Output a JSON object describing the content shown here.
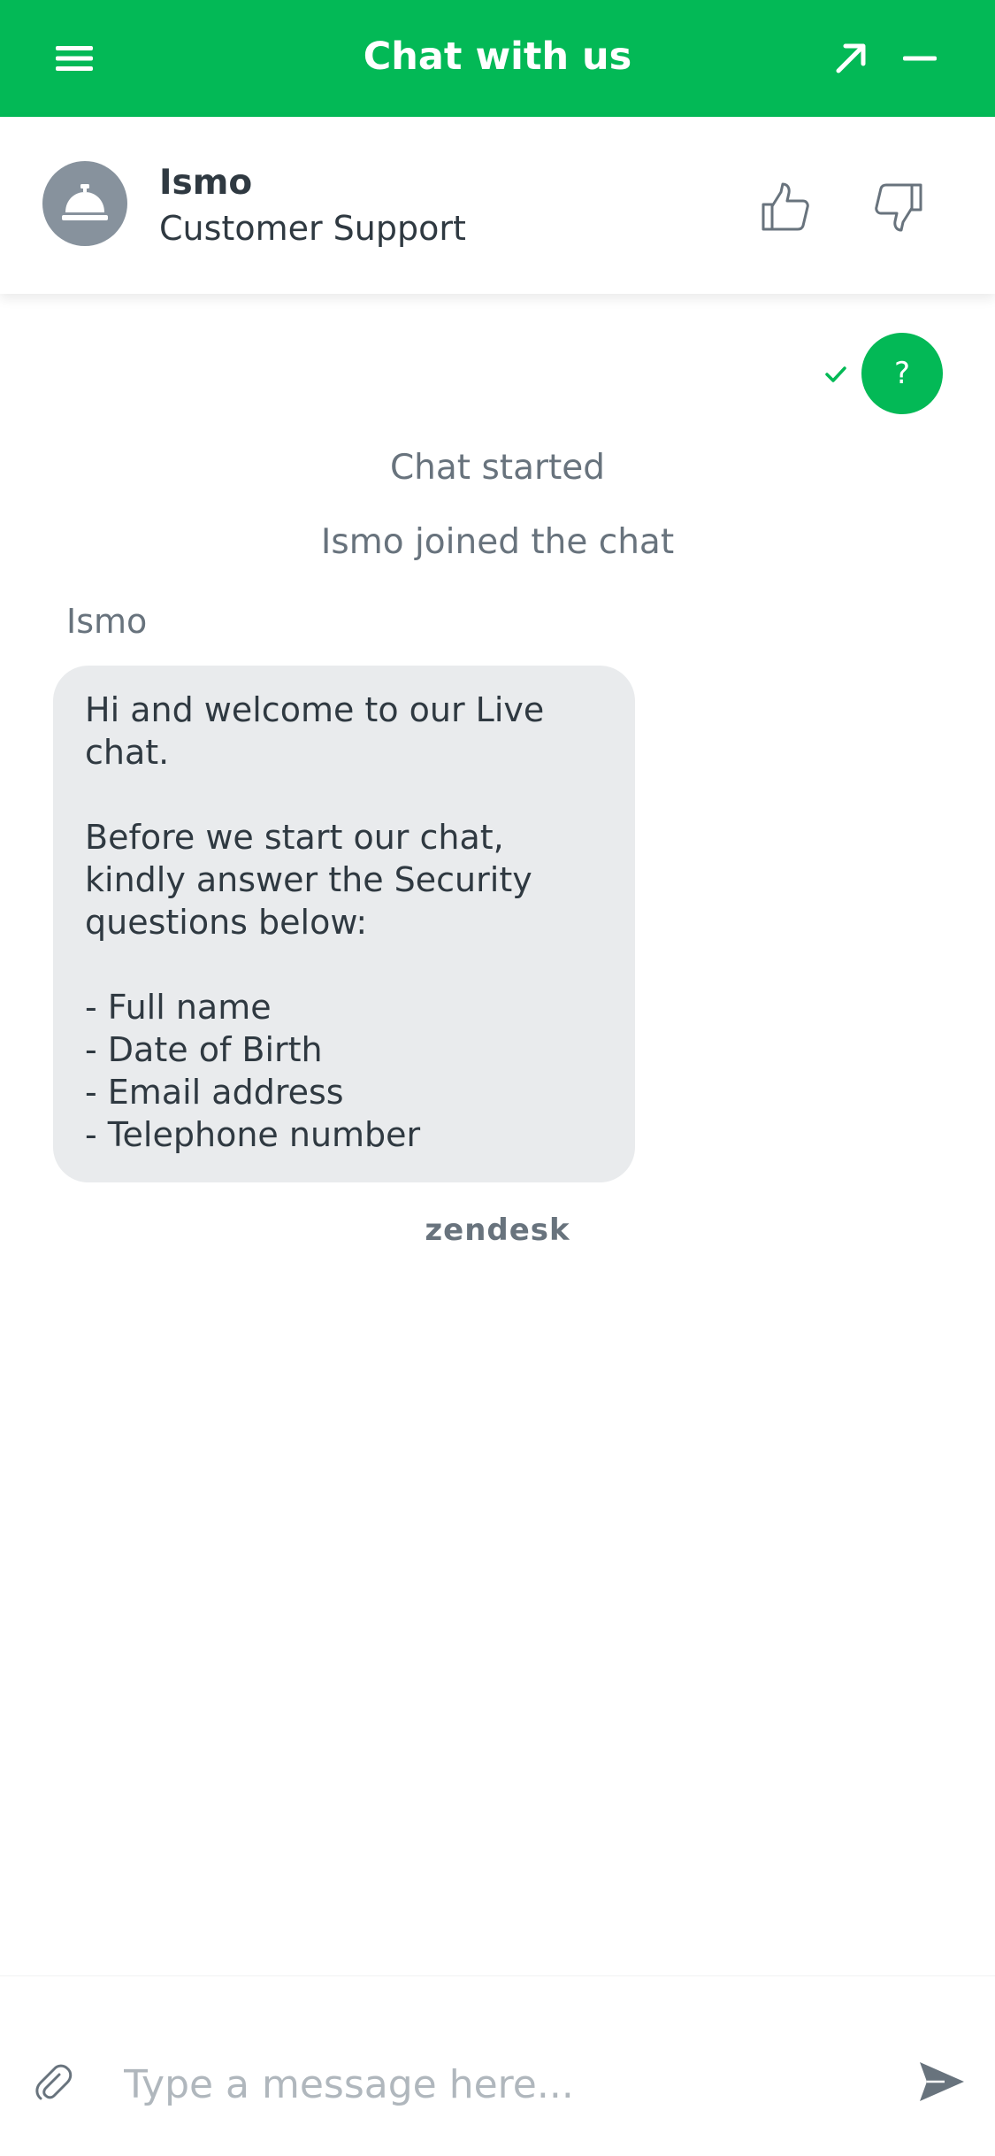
{
  "header": {
    "title": "Chat with us",
    "menu_icon": "hamburger-menu-icon",
    "popout_icon": "popout-arrow-icon",
    "minimize_icon": "minimize-icon",
    "brand_color": "#03b956"
  },
  "agent": {
    "name": "Ismo",
    "role": "Customer Support",
    "avatar_icon": "concierge-bell-icon",
    "rate_up_icon": "thumbs-up-icon",
    "rate_down_icon": "thumbs-down-icon"
  },
  "chat": {
    "visitor_message": "?",
    "read_icon": "checkmark-icon",
    "events": {
      "started": "Chat started",
      "joined": "Ismo joined the chat"
    },
    "sender": "Ismo",
    "agent_message": "Hi and welcome to our Live chat.\n\nBefore we start our chat, kindly answer the Security questions below:\n\n- Full name\n- Date of Birth\n- Email address\n- Telephone number",
    "powered_by": "zendesk"
  },
  "composer": {
    "placeholder": "Type a message here...",
    "value": "",
    "attach_icon": "paperclip-icon",
    "send_icon": "send-icon"
  }
}
